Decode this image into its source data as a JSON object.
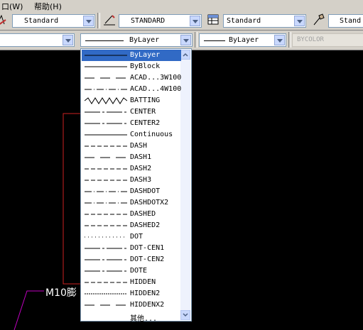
{
  "menubar": {
    "item_window": "口(W)",
    "item_help": "帮助(H)"
  },
  "toolbar1": {
    "text_style": "Standard",
    "dim_style": "STANDARD",
    "table_style": "Standard",
    "mleader_style": "Stand"
  },
  "toolbar2": {
    "layer": "",
    "linetype": "ByLayer",
    "lineweight": "ByLayer",
    "plotstyle": "BYCOLOR"
  },
  "drawing": {
    "label": "M10膨"
  },
  "linetype_list": {
    "items": [
      {
        "label": "ByLayer",
        "pattern": "solid"
      },
      {
        "label": "ByBlock",
        "pattern": "solid"
      },
      {
        "label": "ACAD...3W100",
        "pattern": "dash-long"
      },
      {
        "label": "ACAD...4W100",
        "pattern": "dashdot"
      },
      {
        "label": "BATTING",
        "pattern": "zigzag"
      },
      {
        "label": "CENTER",
        "pattern": "center"
      },
      {
        "label": "CENTER2",
        "pattern": "center"
      },
      {
        "label": "Continuous",
        "pattern": "solid"
      },
      {
        "label": "DASH",
        "pattern": "dash"
      },
      {
        "label": "DASH1",
        "pattern": "dash-long"
      },
      {
        "label": "DASH2",
        "pattern": "dash"
      },
      {
        "label": "DASH3",
        "pattern": "dash"
      },
      {
        "label": "DASHDOT",
        "pattern": "dashdot"
      },
      {
        "label": "DASHDOTX2",
        "pattern": "dashdot"
      },
      {
        "label": "DASHED",
        "pattern": "dash"
      },
      {
        "label": "DASHED2",
        "pattern": "dash"
      },
      {
        "label": "DOT",
        "pattern": "dot"
      },
      {
        "label": "DOT-CEN1",
        "pattern": "center"
      },
      {
        "label": "DOT-CEN2",
        "pattern": "center"
      },
      {
        "label": "DOTE",
        "pattern": "center"
      },
      {
        "label": "HIDDEN",
        "pattern": "dash"
      },
      {
        "label": "HIDDEN2",
        "pattern": "hidden"
      },
      {
        "label": "HIDDENX2",
        "pattern": "dash-long"
      },
      {
        "label": "其他...",
        "pattern": "none"
      }
    ],
    "selected": "ByLayer"
  },
  "colors": {
    "selection": "#316ac5",
    "drawing_bg": "#000000",
    "red_frame": "#cc2222",
    "magenta": "#c000c0"
  }
}
